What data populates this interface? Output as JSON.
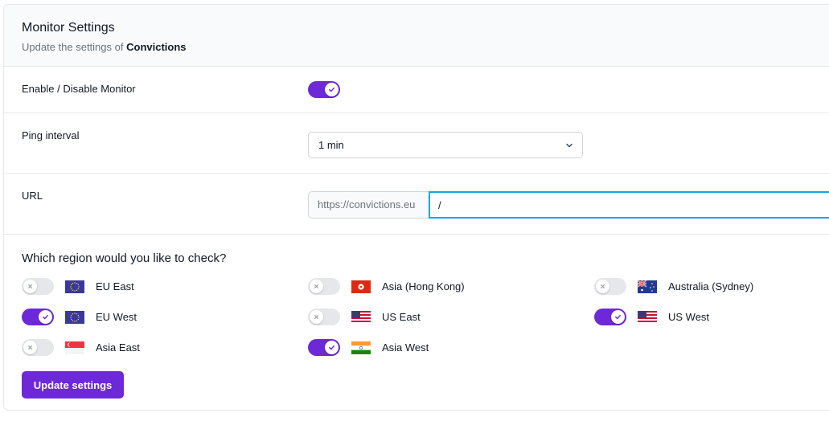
{
  "header": {
    "title": "Monitor Settings",
    "subtitle_prefix": "Update the settings of",
    "monitor_name": "Convictions"
  },
  "enable": {
    "label": "Enable / Disable Monitor",
    "on": true
  },
  "ping": {
    "label": "Ping interval",
    "value": "1 min"
  },
  "url": {
    "label": "URL",
    "prefix": "https://convictions.eu",
    "path": "/"
  },
  "regions": {
    "question": "Which region would you like to check?",
    "items": [
      {
        "label": "EU East",
        "flag": "eu-flag-icon",
        "on": false
      },
      {
        "label": "Asia (Hong Kong)",
        "flag": "hong-kong-flag-icon",
        "on": false
      },
      {
        "label": "Australia (Sydney)",
        "flag": "australia-flag-icon",
        "on": false
      },
      {
        "label": "EU West",
        "flag": "eu-flag-icon",
        "on": true
      },
      {
        "label": "US East",
        "flag": "us-flag-icon",
        "on": false
      },
      {
        "label": "US West",
        "flag": "us-flag-icon",
        "on": true
      },
      {
        "label": "Asia East",
        "flag": "singapore-flag-icon",
        "on": false
      },
      {
        "label": "Asia West",
        "flag": "india-flag-icon",
        "on": true
      }
    ]
  },
  "actions": {
    "update_label": "Update settings"
  },
  "colors": {
    "accent": "#6d28d9",
    "focus": "#0ea5e9",
    "toggle_off": "#e5e7eb"
  }
}
